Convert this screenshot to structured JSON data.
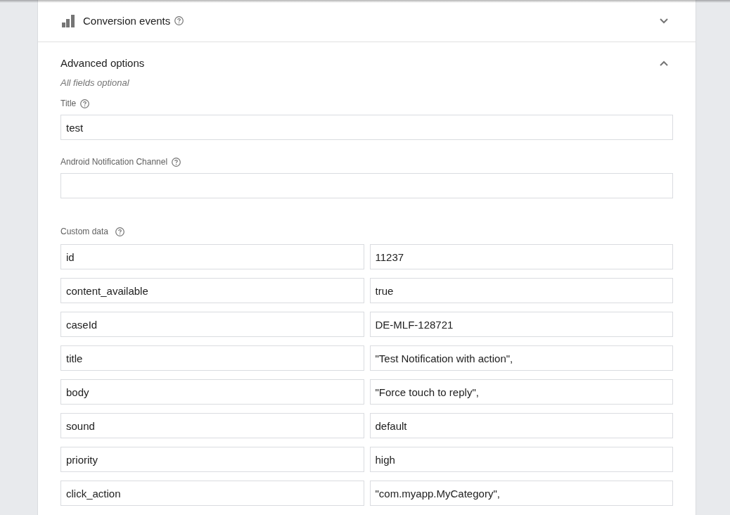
{
  "conversion_events": {
    "title": "Conversion events",
    "expanded": false
  },
  "advanced_options": {
    "title": "Advanced options",
    "expanded": true,
    "subtitle": "All fields optional",
    "fields": [
      {
        "label": "Title",
        "value": "test"
      },
      {
        "label": "Android Notification Channel"
      }
    ],
    "custom_data": {
      "label": "Custom data",
      "rows": [
        {
          "key": "id",
          "value": "11237"
        },
        {
          "key": "content_available",
          "value": "true"
        },
        {
          "key": "caseId",
          "value": "DE-MLF-128721"
        },
        {
          "key": "title",
          "value": "\"Test Notification with action\","
        },
        {
          "key": "body",
          "value": "\"Force touch to reply\","
        },
        {
          "key": "sound",
          "value": "default"
        },
        {
          "key": "priority",
          "value": "high"
        },
        {
          "key": "click_action",
          "value": "\"com.myapp.MyCategory\","
        }
      ]
    }
  }
}
